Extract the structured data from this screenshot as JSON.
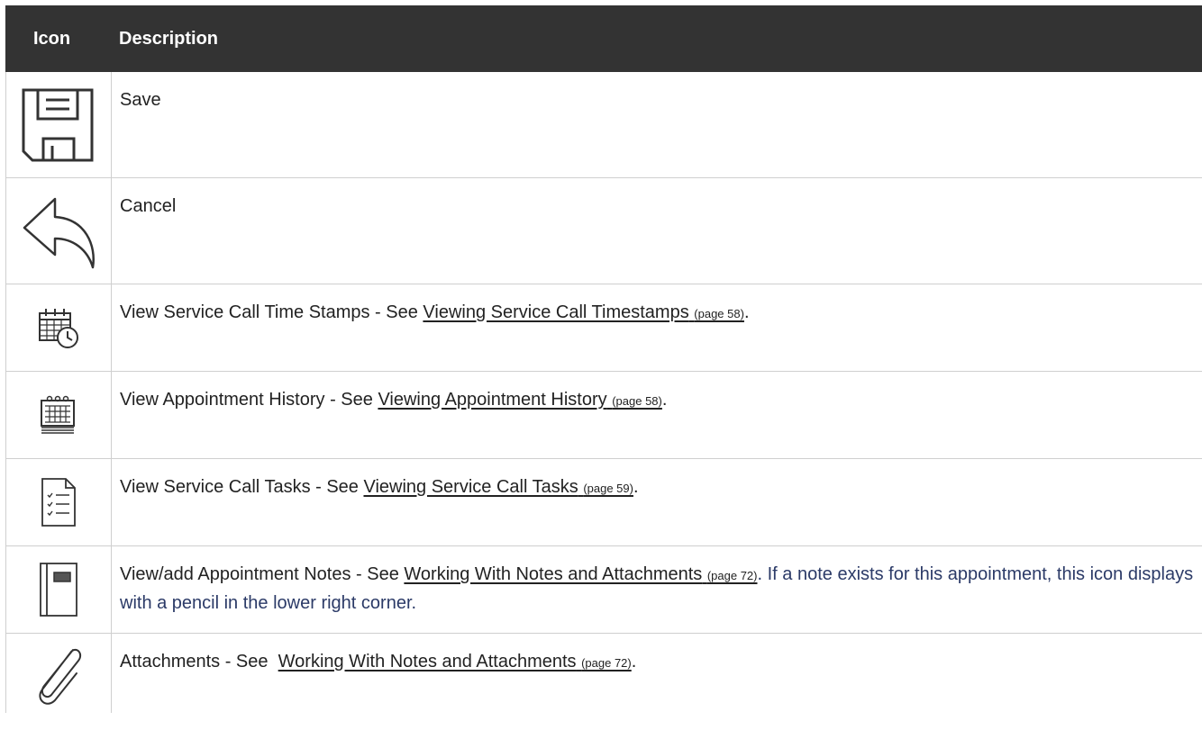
{
  "table": {
    "headers": {
      "icon": "Icon",
      "description": "Description"
    },
    "rows": [
      {
        "icon": "save-icon",
        "text": "Save"
      },
      {
        "icon": "cancel-icon",
        "text": "Cancel"
      },
      {
        "icon": "timestamps-icon",
        "prefix": "View Service Call Time Stamps - See ",
        "link": "Viewing Service Call Timestamps",
        "page": "(page 58)",
        "suffix": "."
      },
      {
        "icon": "appointment-history-icon",
        "prefix": "View Appointment History - See ",
        "link": "Viewing Appointment History",
        "page": "(page 58)",
        "suffix": "."
      },
      {
        "icon": "tasks-icon",
        "prefix": "View Service Call Tasks - See ",
        "link": "Viewing Service Call Tasks",
        "page": "(page 59)",
        "suffix": "."
      },
      {
        "icon": "notes-icon",
        "prefix": "View/add Appointment Notes - See ",
        "link": "Working With Notes and Attachments",
        "page": "(page 72)",
        "suffix": ". ",
        "note": "If a note exists for this appointment, this icon displays with a pencil in the lower right corner."
      },
      {
        "icon": "paperclip-icon",
        "prefix": "Attachments - See  ",
        "link": "Working With Notes and Attachments",
        "page": "(page 72)",
        "suffix": "."
      }
    ]
  }
}
